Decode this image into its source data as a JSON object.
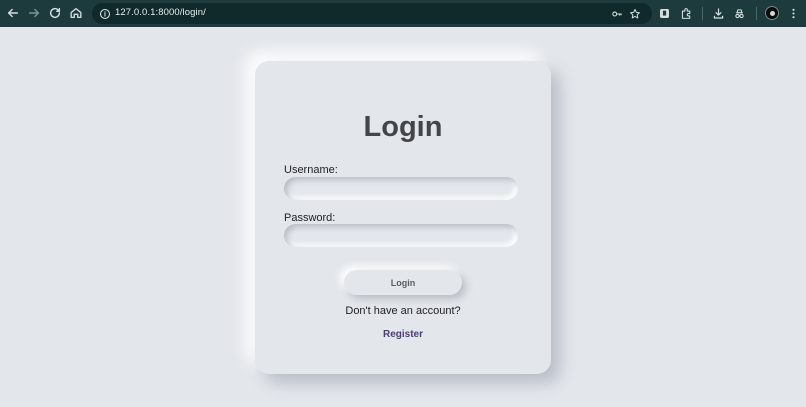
{
  "browser": {
    "url": "127.0.0.1:8000/login/",
    "toolbar_color": "#1d3a3d"
  },
  "page": {
    "background": "#e3e6eb",
    "title": "Login",
    "username_label": "Username:",
    "username_value": "",
    "password_label": "Password:",
    "password_value": "",
    "login_button": "Login",
    "no_account_text": "Don't have an account?",
    "register_link": "Register",
    "register_link_color": "#4d3b78"
  }
}
